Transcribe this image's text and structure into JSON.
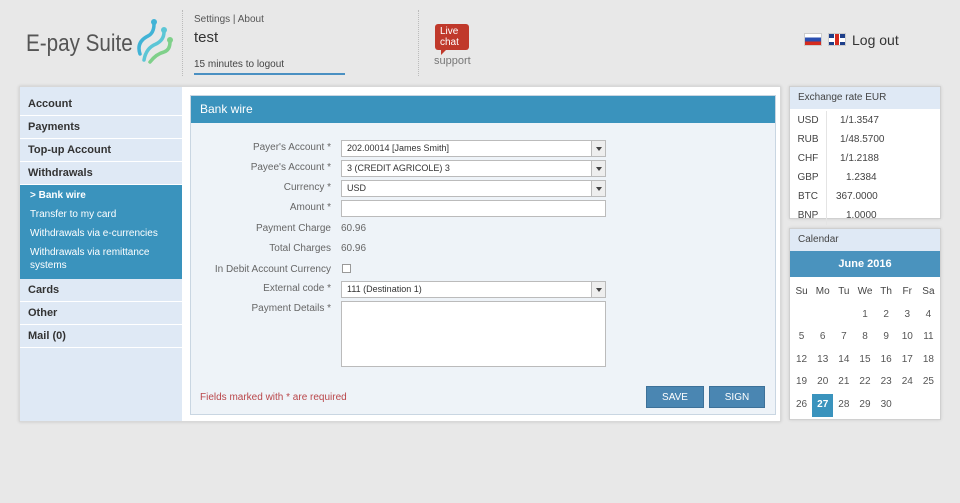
{
  "header": {
    "logo_text": "E-pay Suite",
    "settings_label": "Settings",
    "about_label": "About",
    "link_separator": " | ",
    "username": "test",
    "logout_timer": "15 minutes to logout",
    "chat_label_line1": "Live",
    "chat_label_line2": "chat",
    "support_label": "support",
    "logout_label": "Log out"
  },
  "sidebar": {
    "items_top": [
      {
        "label": "Account"
      },
      {
        "label": "Payments"
      },
      {
        "label": "Top-up Account"
      },
      {
        "label": "Withdrawals"
      }
    ],
    "subitems": [
      {
        "label": "> Bank wire",
        "active": true
      },
      {
        "label": "Transfer to my card"
      },
      {
        "label": "Withdrawals via e-currencies"
      },
      {
        "label": "Withdrawals via remittance systems"
      }
    ],
    "items_bottom": [
      {
        "label": "Cards"
      },
      {
        "label": "Other"
      },
      {
        "label": "Mail (0)"
      }
    ]
  },
  "form": {
    "title": "Bank wire",
    "payers_account_label": "Payer's Account *",
    "payers_account_value": "202.00014 [James Smith]",
    "payees_account_label": "Payee's Account *",
    "payees_account_value": "3 (CREDIT AGRICOLE) 3",
    "currency_label": "Currency *",
    "currency_value": "USD",
    "amount_label": "Amount *",
    "amount_value": "",
    "payment_charge_label": "Payment Charge",
    "payment_charge_value": "60.96",
    "total_charges_label": "Total Charges",
    "total_charges_value": "60.96",
    "debit_currency_label": "In Debit Account Currency",
    "external_code_label": "External code *",
    "external_code_value": "111 (Destination 1)",
    "payment_details_label": "Payment Details *",
    "required_note": "Fields marked with * are required",
    "save_label": "SAVE",
    "sign_label": "SIGN"
  },
  "rates": {
    "title": "Exchange rate EUR",
    "rows": [
      {
        "cur": "USD",
        "val": "1/1.3547"
      },
      {
        "cur": "RUB",
        "val": "1/48.5700"
      },
      {
        "cur": "CHF",
        "val": "1/1.2188"
      },
      {
        "cur": "GBP",
        "val": "1.2384"
      },
      {
        "cur": "BTC",
        "val": "367.0000"
      },
      {
        "cur": "BNP",
        "val": "1.0000"
      }
    ]
  },
  "calendar": {
    "title": "Calendar",
    "month": "June 2016",
    "weekdays": [
      "Su",
      "Mo",
      "Tu",
      "We",
      "Th",
      "Fr",
      "Sa"
    ],
    "weeks": [
      [
        "",
        "",
        "",
        "1",
        "2",
        "3",
        "4"
      ],
      [
        "5",
        "6",
        "7",
        "8",
        "9",
        "10",
        "11"
      ],
      [
        "12",
        "13",
        "14",
        "15",
        "16",
        "17",
        "18"
      ],
      [
        "19",
        "20",
        "21",
        "22",
        "23",
        "24",
        "25"
      ],
      [
        "26",
        "27",
        "28",
        "29",
        "30",
        "",
        ""
      ]
    ],
    "today": "27",
    "accent_color": "#3a93bd"
  }
}
